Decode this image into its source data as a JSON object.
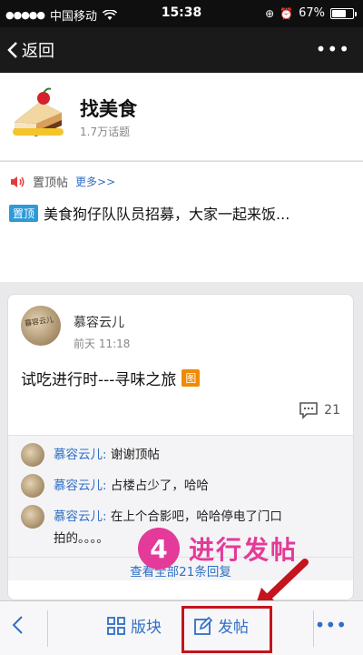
{
  "status_bar": {
    "carrier": "中国移动",
    "time": "15:38",
    "battery": "67%",
    "battery_fraction": 0.67
  },
  "nav": {
    "back_label": "返回"
  },
  "header": {
    "title": "找美食",
    "subtitle": "1.7万话题"
  },
  "pinned": {
    "label": "置顶帖",
    "more": "更多>>",
    "tag": "置顶",
    "item_text": "美食狗仔队队员招募，大家一起来饭..."
  },
  "post": {
    "author": "慕容云儿",
    "avatar_text": "暮容云儿",
    "time": "前天 11:18",
    "title": "试吃进行时---寻味之旅",
    "image_tag": "图",
    "comment_count": "21",
    "replies": [
      {
        "name": "慕容云儿:",
        "text": "谢谢顶帖"
      },
      {
        "name": "慕容云儿:",
        "text": "占楼占少了，哈哈"
      },
      {
        "name": "慕容云儿:",
        "text": "在上个合影吧，哈哈停电了门口\n拍的。。。。"
      }
    ],
    "view_all": "查看全部21条回复"
  },
  "annotation": {
    "number": "4",
    "text": "进行发帖"
  },
  "bottom_bar": {
    "section_label": "版块",
    "post_label": "发帖"
  },
  "colors": {
    "accent": "#2f6fc4",
    "annotation": "#e43a99",
    "highlight": "#c4141d"
  }
}
